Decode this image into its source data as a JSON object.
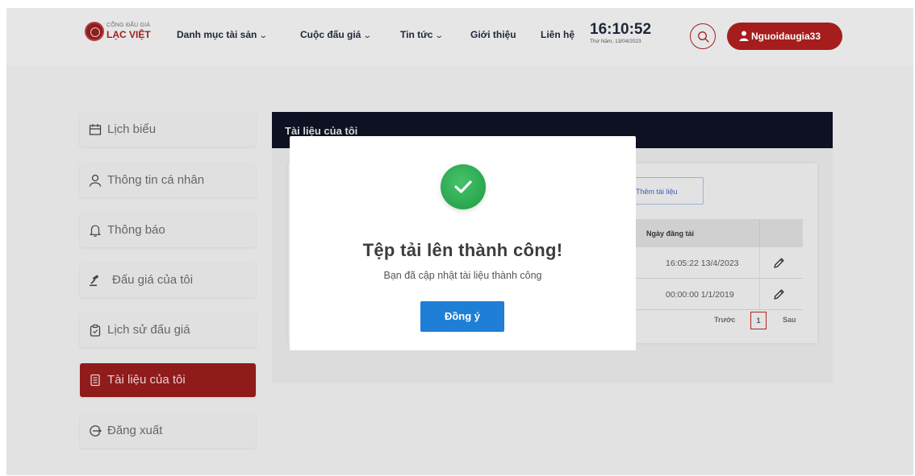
{
  "brand": {
    "top_text": "CỔNG ĐẤU GIÁ",
    "name": "LẠC VIỆT"
  },
  "nav": [
    {
      "label": "Danh mục tài sản",
      "chevron": true
    },
    {
      "label": "Cuộc đấu giá",
      "chevron": true
    },
    {
      "label": "Tin tức",
      "chevron": true
    },
    {
      "label": "Giới thiệu",
      "chevron": false
    },
    {
      "label": "Liên hệ",
      "chevron": false
    }
  ],
  "clock": {
    "time": "16:10:52",
    "date": "Thứ Năm, 13/04/2023"
  },
  "user": {
    "name": "Nguoidaugia33"
  },
  "sidebar": {
    "items": [
      {
        "label": "Lịch biểu",
        "icon": "calendar-icon",
        "active": false
      },
      {
        "label": "Thông tin cá nhân",
        "icon": "user-icon",
        "active": false
      },
      {
        "label": "Thông báo",
        "icon": "bell-icon",
        "active": false
      },
      {
        "label": "Đấu giá của tôi",
        "icon": "gavel-icon",
        "active": false
      },
      {
        "label": "Lịch sử đấu giá",
        "icon": "clipboard-icon",
        "active": false
      },
      {
        "label": "Tài liệu của tôi",
        "icon": "document-icon",
        "active": true
      },
      {
        "label": "Đăng xuất",
        "icon": "logout-icon",
        "active": false
      }
    ]
  },
  "panel": {
    "title": "Tài liệu của tôi",
    "add_button": "Thêm tài liệu",
    "columns": {
      "date": "Ngày đăng tải"
    },
    "rows": [
      {
        "date": "16:05:22 13/4/2023"
      },
      {
        "date": "00:00:00 1/1/2019"
      }
    ],
    "pager": {
      "prev": "Trước",
      "current": "1",
      "next": "Sau"
    }
  },
  "modal": {
    "title": "Tệp tải lên thành công!",
    "message": "Bạn đã cập nhật tài liệu thành công",
    "ok_label": "Đồng ý"
  },
  "colors": {
    "brand_red": "#a61d1d",
    "panel_dark": "#0d1121",
    "ok_blue": "#1f7fd6",
    "success_green": "#2aa64f"
  }
}
